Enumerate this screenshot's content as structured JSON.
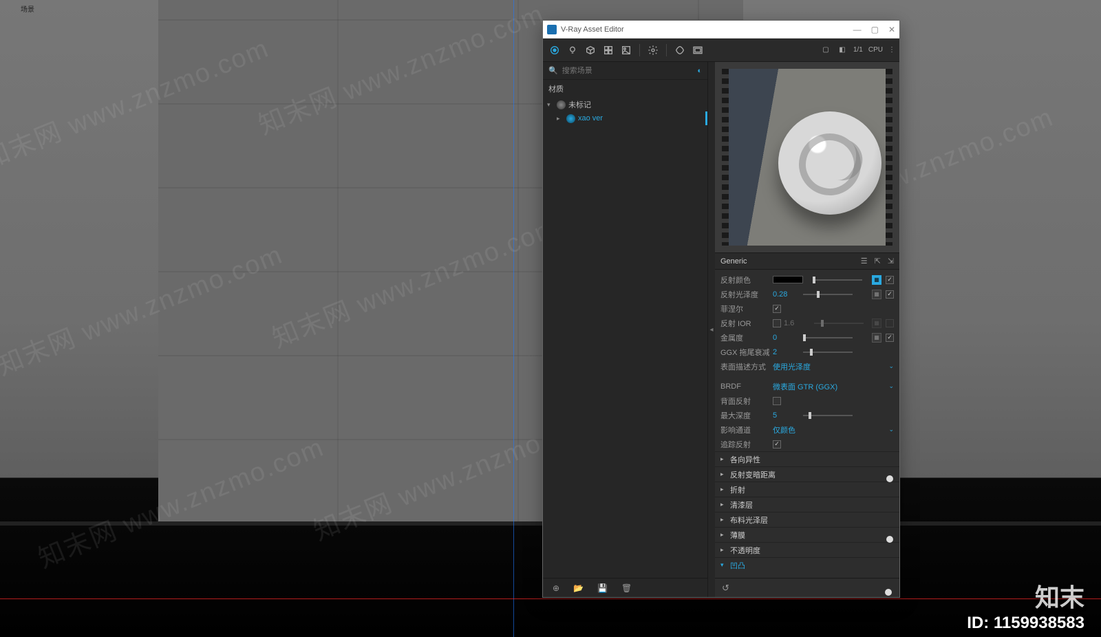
{
  "page": {
    "top_left_label": "场景",
    "logo_text": "知末",
    "id_text": "ID: 1159938583",
    "watermark": "知末网 www.znzmo.com"
  },
  "window": {
    "title": "V-Ray Asset Editor",
    "search_placeholder": "搜索场景",
    "render_badge": "1/1",
    "render_mode": "CPU"
  },
  "material_tree": {
    "header": "材质",
    "items": [
      {
        "label": "未标记",
        "selected": false
      },
      {
        "label": "xao ver",
        "selected": true
      }
    ]
  },
  "generic": {
    "title": "Generic",
    "props": {
      "reflect_color": {
        "label": "反射颜色"
      },
      "reflect_gloss": {
        "label": "反射光泽度",
        "value": "0.28"
      },
      "fresnel": {
        "label": "菲涅尔",
        "checked": true
      },
      "reflect_ior": {
        "label": "反射 IOR",
        "value": "1.6",
        "enabled": false
      },
      "metalness": {
        "label": "金属度",
        "value": "0"
      },
      "ggx_tail": {
        "label": "GGX 拖尾衰减",
        "value": "2"
      },
      "surface_control": {
        "label": "表面描述方式",
        "value": "使用光泽度"
      },
      "brdf": {
        "label": "BRDF",
        "value": "微表面 GTR (GGX)"
      },
      "back_reflect": {
        "label": "背面反射",
        "checked": false
      },
      "max_depth": {
        "label": "最大深度",
        "value": "5"
      },
      "affect_channels": {
        "label": "影响通道",
        "value": "仅颜色"
      },
      "trace_reflect": {
        "label": "追踪反射",
        "checked": true
      }
    },
    "groups": {
      "anisotropy": "各向异性",
      "reflect_dim": "反射变暗距离",
      "refraction": "折射",
      "coat": "清漆层",
      "sheen": "布料光泽层",
      "thin_film": "薄膜",
      "opacity": "不透明度",
      "bump": "凹凸"
    }
  }
}
